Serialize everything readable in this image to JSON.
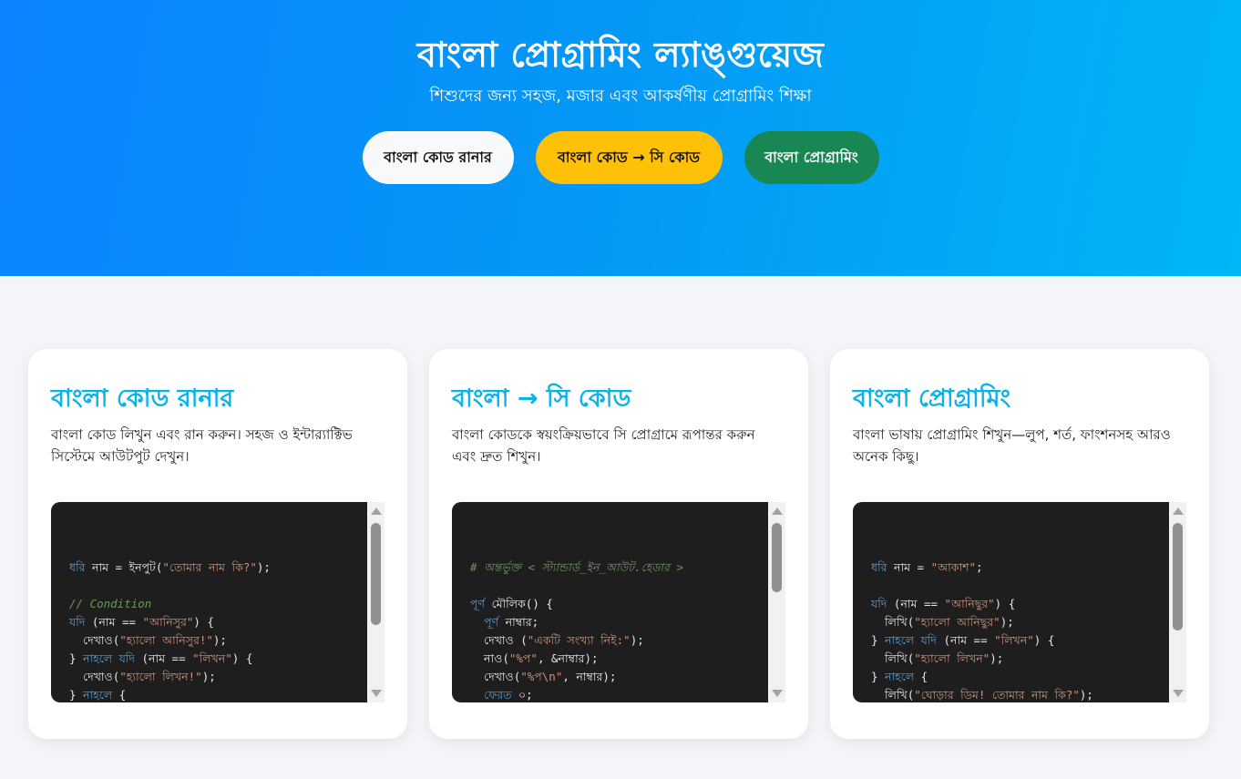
{
  "hero": {
    "title": "বাংলা প্রোগ্রামিং ল্যাঙ্গুয়েজ",
    "subtitle": "শিশুদের জন্য সহজ, মজার এবং আকর্ষণীয় প্রোগ্রামিং শিক্ষা",
    "buttons": [
      {
        "label": "বাংলা কোড রানার"
      },
      {
        "label": "বাংলা কোড → সি কোড"
      },
      {
        "label": "বাংলা প্রোগ্রামিং"
      }
    ]
  },
  "cards": [
    {
      "title": "বাংলা কোড রানার",
      "description": "বাংলা কোড লিখুন এবং রান করুন। সহজ ও ইন্টার‍্যাক্টিভ সিস্টেমে আউটপুট দেখুন।",
      "code_lines": [
        "ধরি নাম = ইনপুট(\"তোমার নাম কি?\");",
        "",
        "// Condition",
        "যদি (নাম == \"আনিসুর\") {",
        "  দেখাও(\"হ্যালো আনিসুর!\");",
        "} নাহলে যদি (নাম == \"লিখন\") {",
        "  দেখাও(\"হ্যালো লিখন!\");",
        "} নাহলে {"
      ],
      "scroll_position": 0.1
    },
    {
      "title": "বাংলা → সি কোড",
      "description": "বাংলা কোডকে স্বয়ংক্রিয়ভাবে সি প্রোগ্রামে রূপান্তর করুন এবং দ্রুত শিখুন।",
      "code_lines": [
        "# অন্তর্ভুক্ত < স্ট্যান্ডার্ড_ইন_আউট.হেডার >",
        "",
        "পূর্ণ মৌলিক() {",
        "  পূর্ণ নাম্বার;",
        "  দেখাও (\"একটি সংখ্যা নিই:\");",
        "  নাও(\"%প\", &নাম্বার);",
        "  দেখাও(\"%প\\n\", নাম্বার);",
        "  ফেরত ০;"
      ],
      "scroll_position": 0.1
    },
    {
      "title": "বাংলা প্রোগ্রামিং",
      "description": "বাংলা ভাষায় প্রোগ্রামিং শিখুন—লুপ, শর্ত, ফাংশনসহ আরও অনেক কিছু।",
      "code_lines": [
        "ধরি নাম = \"আকাশ\";",
        "",
        "যদি (নাম == \"আনিছুর\") {",
        "  লিখি(\"হ্যালো আনিছুর\");",
        "} নাহলে যদি (নাম == \"লিখন\") {",
        "  লিখি(\"হ্যালো লিখন\");",
        "} নাহলে {",
        "  লিখি(\"ঘোড়ার ডিম! তোমার নাম কি?\");"
      ],
      "scroll_position": 0.1
    }
  ],
  "colors": {
    "hero_gradient_start": "#0a84ff",
    "hero_gradient_end": "#00b6f5",
    "card_title": "#0ab2e8",
    "button_white": "#f8f9fa",
    "button_yellow": "#ffc107",
    "button_green": "#198754",
    "code_bg": "#1e1e1e"
  }
}
